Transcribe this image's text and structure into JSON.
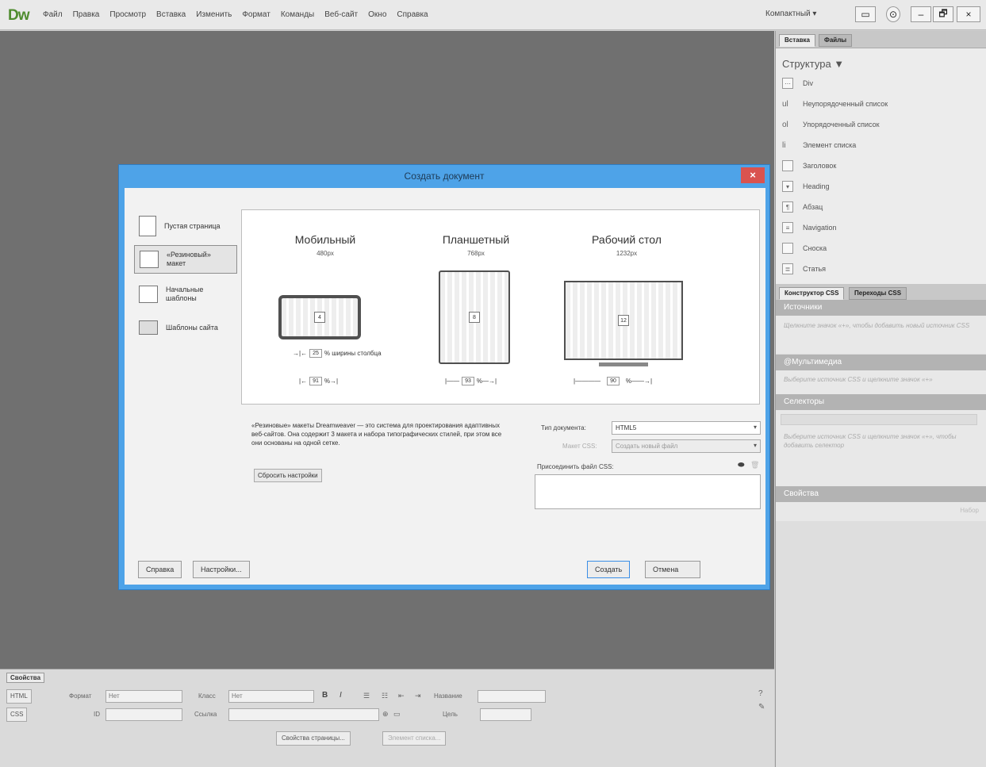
{
  "app": {
    "logo": "Dw",
    "menu": [
      "Файл",
      "Правка",
      "Просмотр",
      "Вставка",
      "Изменить",
      "Формат",
      "Команды",
      "Веб-сайт",
      "Окно",
      "Справка"
    ],
    "workspace": "Компактный ▾",
    "window_controls": [
      "–",
      "🗗",
      "×"
    ]
  },
  "right_panel": {
    "insert_tabs": [
      "Вставка",
      "Файлы"
    ],
    "structure_label": "Структура ▼",
    "insert_items": [
      {
        "icon": "div-icon",
        "label": "Div"
      },
      {
        "icon": "ul-icon",
        "label": "Неупорядоченный список"
      },
      {
        "icon": "ol-icon",
        "label": "Упорядоченный список"
      },
      {
        "icon": "li-icon",
        "label": "Элемент списка"
      },
      {
        "icon": "header-icon",
        "label": "Заголовок"
      },
      {
        "icon": "heading-icon",
        "label": "Heading"
      },
      {
        "icon": "paragraph-icon",
        "label": "Абзац"
      },
      {
        "icon": "navigation-icon",
        "label": "Navigation"
      },
      {
        "icon": "aside-icon",
        "label": "Сноска"
      },
      {
        "icon": "article-icon",
        "label": "Статья"
      }
    ],
    "insert_text_icons": [
      "ul",
      "ol",
      "li"
    ],
    "css_tabs": [
      "Конструктор CSS",
      "Переходы CSS"
    ],
    "sections": {
      "sources": "Источники",
      "sources_hint": "Щелкните значок «+», чтобы добавить новый источник CSS",
      "media": "@Мультимедиа",
      "media_hint": "Выберите источник CSS и щелкните значок «+»",
      "selectors": "Селекторы",
      "selectors_hint": "Выберите источник CSS и щелкните значок «+», чтобы добавить селектор",
      "properties": "Свойства",
      "show_set": "Набор"
    }
  },
  "dialog": {
    "title": "Создать документ",
    "categories": [
      {
        "label": "Пустая страница"
      },
      {
        "label": "«Резиновый» макет"
      },
      {
        "label": "Начальные шаблоны"
      },
      {
        "label": "Шаблоны сайта"
      }
    ],
    "devices": [
      {
        "name": "Мобильный",
        "px": "480px",
        "cols": "4",
        "width_pct": "91"
      },
      {
        "name": "Планшетный",
        "px": "768px",
        "cols": "8",
        "width_pct": "93"
      },
      {
        "name": "Рабочий стол",
        "px": "1232px",
        "cols": "12",
        "width_pct": "90"
      }
    ],
    "gutter_value": "25",
    "gutter_label": "% ширины столбца",
    "pct_sign": "%",
    "description": "«Резиновые» макеты Dreamweaver — это система для проектирования адаптивных веб-сайтов. Она содержит 3 макета и набора типографических стилей, при этом все они основаны на одной сетке.",
    "reset_button": "Сбросить настройки",
    "doc_type_label": "Тип документа:",
    "doc_type_value": "HTML5",
    "layout_css_label": "Макет CSS:",
    "layout_css_value": "Создать новый файл",
    "attach_css_label": "Присоединить файл CSS:",
    "buttons": {
      "help": "Справка",
      "settings": "Настройки...",
      "create": "Создать",
      "cancel": "Отмена"
    }
  },
  "properties_panel": {
    "tab": "Свойства",
    "html_btn": "HTML",
    "css_btn": "CSS",
    "format_label": "Формат",
    "format_value": "Нет",
    "class_label": "Класс",
    "class_value": "Нет",
    "id_label": "ID",
    "link_label": "Ссылка",
    "title_label": "Название",
    "target_label": "Цель",
    "bold": "B",
    "italic": "I",
    "page_props_button": "Свойства страницы...",
    "list_item_button": "Элемент списка..."
  }
}
